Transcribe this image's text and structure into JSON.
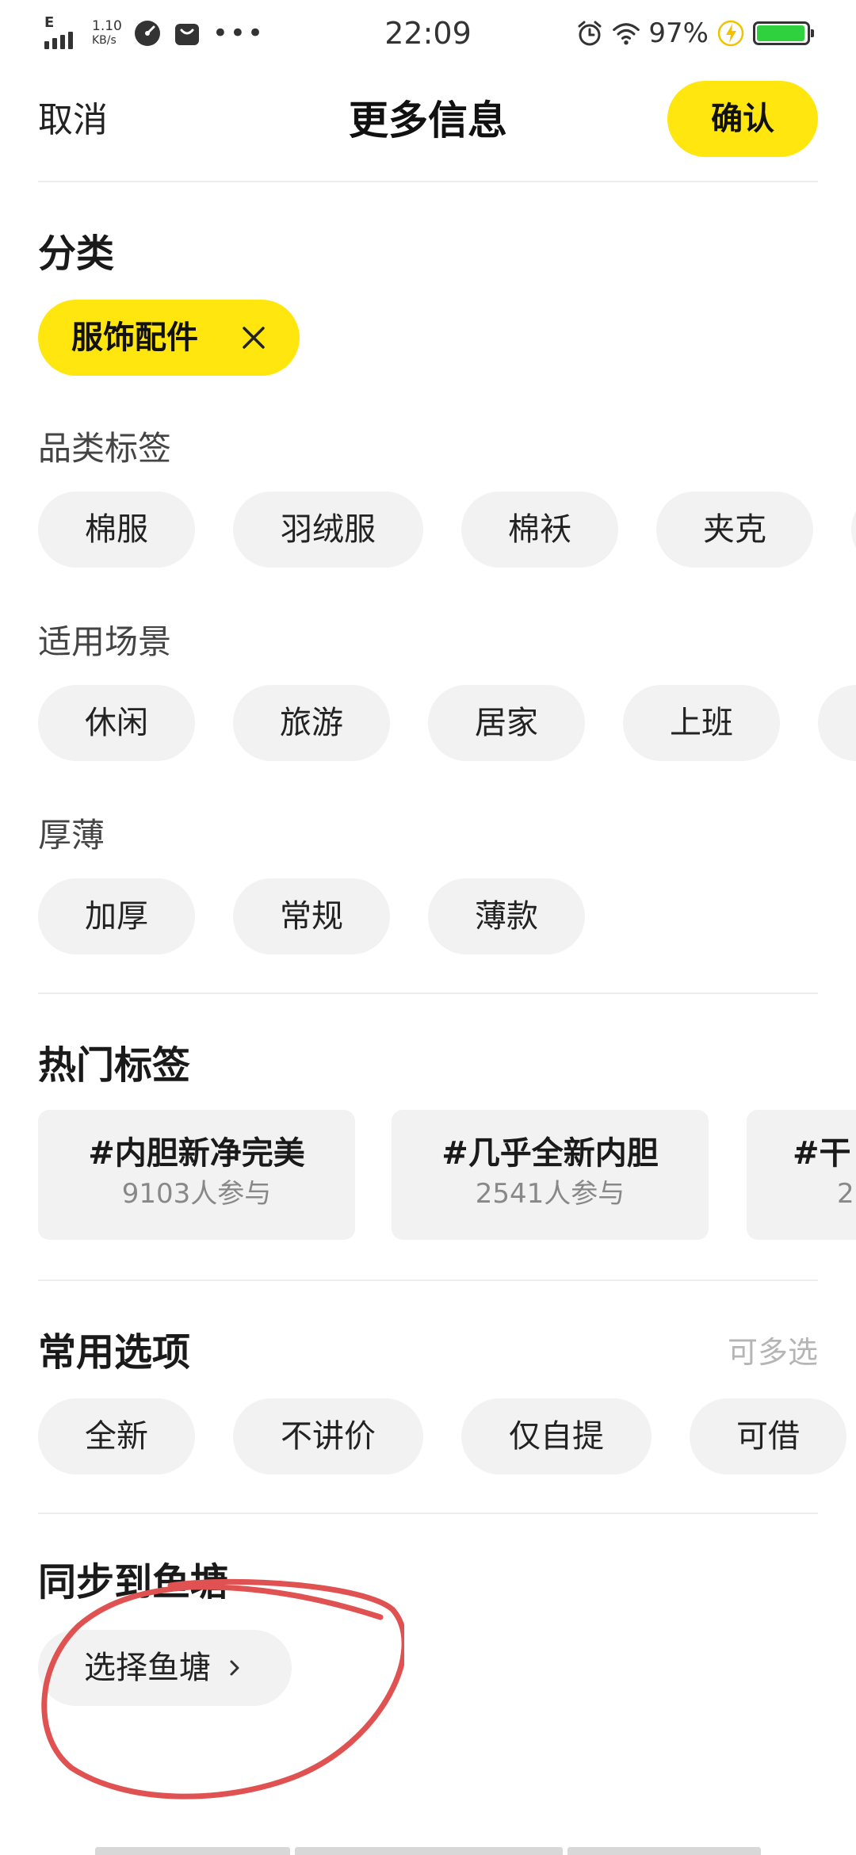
{
  "status_bar": {
    "network_type": "E",
    "net_speed_value": "1.10",
    "net_speed_unit": "KB/s",
    "more_dots": "•••",
    "time": "22:09",
    "battery_percent": "97%",
    "battery_level": 0.97
  },
  "header": {
    "cancel_label": "取消",
    "title": "更多信息",
    "confirm_label": "确认"
  },
  "category": {
    "title": "分类",
    "selected": "服饰配件"
  },
  "product_tags": {
    "title": "品类标签",
    "options": [
      "棉服",
      "羽绒服",
      "棉袄",
      "夹克"
    ]
  },
  "scenarios": {
    "title": "适用场景",
    "options": [
      "休闲",
      "旅游",
      "居家",
      "上班"
    ]
  },
  "thickness": {
    "title": "厚薄",
    "options": [
      "加厚",
      "常规",
      "薄款"
    ]
  },
  "hot_tags": {
    "title": "热门标签",
    "items": [
      {
        "tag": "#内胆新净完美",
        "count": "9103人参与"
      },
      {
        "tag": "#几乎全新内胆",
        "count": "2541人参与"
      },
      {
        "tag": "#干",
        "count": "2"
      }
    ]
  },
  "common_options": {
    "title": "常用选项",
    "hint": "可多选",
    "options": [
      "全新",
      "不讲价",
      "仅自提",
      "可借"
    ]
  },
  "sync": {
    "title": "同步到鱼塘",
    "select_label": "选择鱼塘"
  },
  "colors": {
    "accent": "#ffe60f",
    "chip_bg": "#f2f2f2",
    "annotation": "#e05252",
    "battery": "#2fd13f"
  }
}
